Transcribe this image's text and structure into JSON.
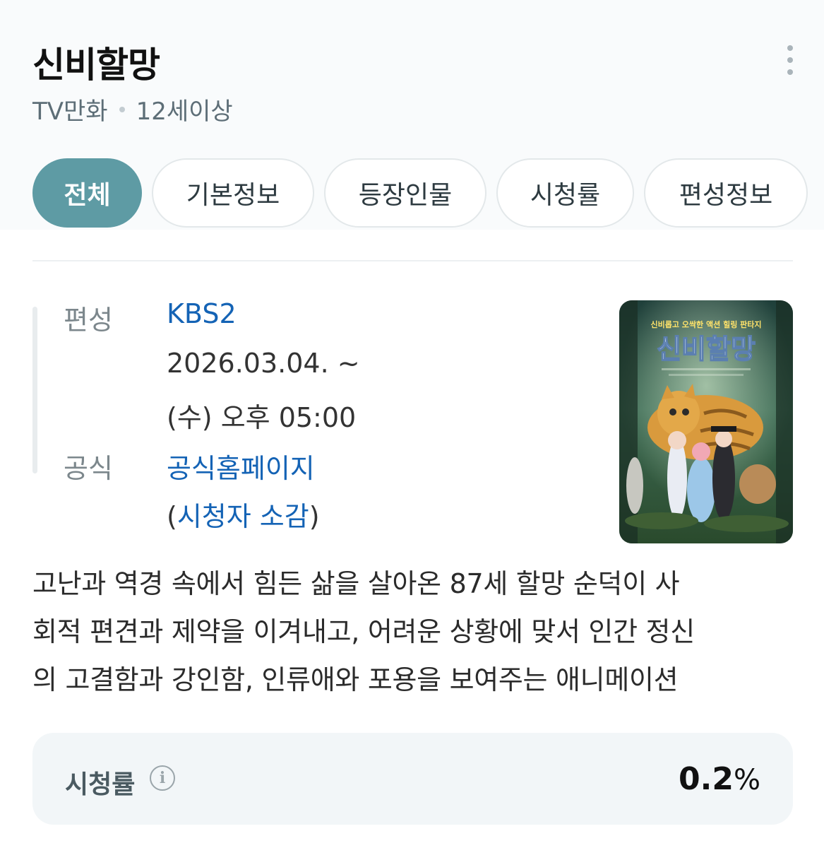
{
  "header": {
    "title": "신비할망",
    "genre": "TV만화",
    "age_rating": "12세이상",
    "more_icon": "more-vertical-icon"
  },
  "tabs": [
    {
      "label": "전체",
      "active": true
    },
    {
      "label": "기본정보",
      "active": false
    },
    {
      "label": "등장인물",
      "active": false
    },
    {
      "label": "시청률",
      "active": false
    },
    {
      "label": "편성정보",
      "active": false
    }
  ],
  "info": {
    "broadcast_label": "편성",
    "channel": "KBS2",
    "date_line": "2026.03.04. ~",
    "time_line": "(수) 오후 05:00",
    "official_label": "공식",
    "homepage_link": "공식홈페이지",
    "reviews_open": "(",
    "reviews_link": "시청자 소감",
    "reviews_close": ")"
  },
  "poster": {
    "tagline": "신비롭고 오싹한 액션 힐링 판타지",
    "title_art": "신비할망"
  },
  "description": {
    "line1": "고난과 역경 속에서 힘든 삶을 살아온 87세 할망 순덕이 사",
    "line2": "회적 편견과 제약을 이겨내고, 어려운 상황에 맞서 인간 정신",
    "line3": "의 고결함과 강인함, 인류애와 포용을 보여주는 애니메이션"
  },
  "rating": {
    "label": "시청률",
    "info_icon": "info-circle-icon",
    "value": "0.2",
    "unit": "%"
  },
  "colors": {
    "accent": "#5e9ba4",
    "link": "#1463b5",
    "card_bg": "#f2f6f8"
  }
}
